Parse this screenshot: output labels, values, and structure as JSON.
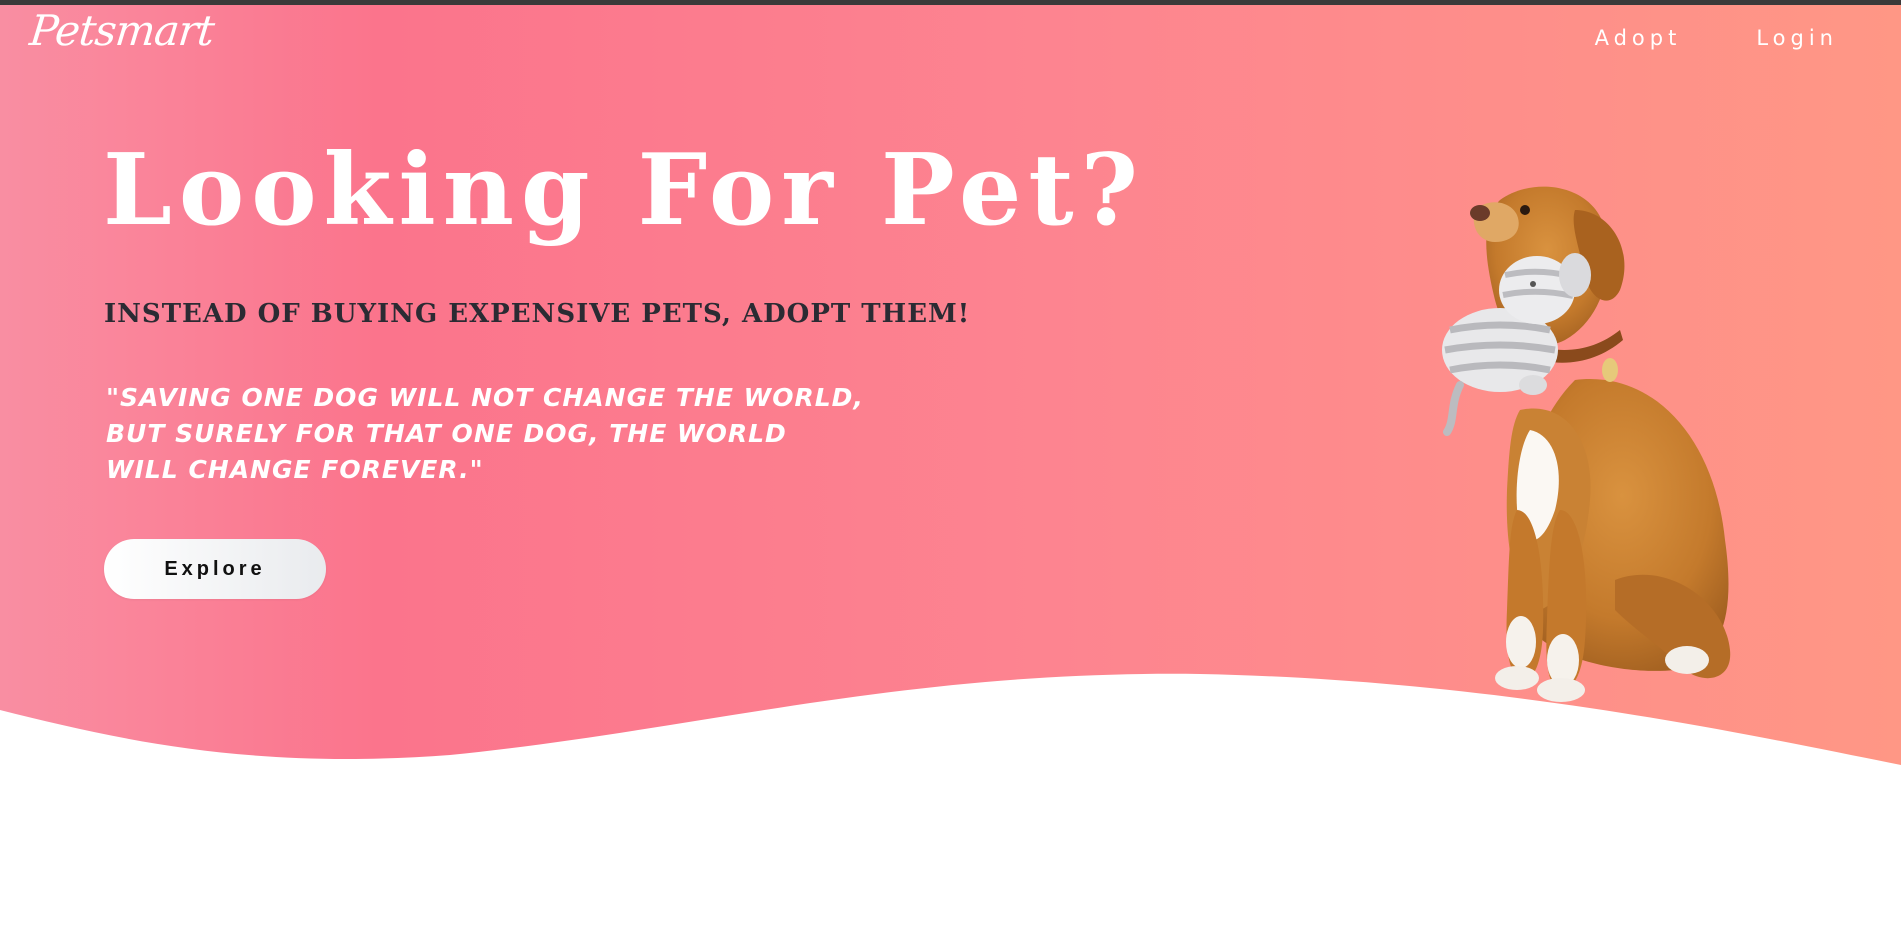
{
  "brand": {
    "logo_text": "Petsmart"
  },
  "nav": {
    "items": [
      {
        "label": "Adopt"
      },
      {
        "label": "Login"
      }
    ]
  },
  "hero": {
    "headline": "Looking For Pet?",
    "subheadline": "INSTEAD OF BUYING EXPENSIVE PETS, ADOPT THEM!",
    "quote_lines": [
      "\"SAVING ONE DOG WILL NOT CHANGE THE WORLD,",
      "BUT SURELY FOR THAT ONE DOG, THE WORLD",
      "WILL CHANGE FOREVER.\""
    ],
    "cta_label": "Explore"
  },
  "colors": {
    "gradient_start": "#f98ba0",
    "gradient_mid": "#fb758d",
    "gradient_end": "#ff9585",
    "subheadline": "#2b2b33",
    "background": "#ffffff"
  },
  "icons": {
    "hero_image": "dog-with-toy-illustration"
  }
}
